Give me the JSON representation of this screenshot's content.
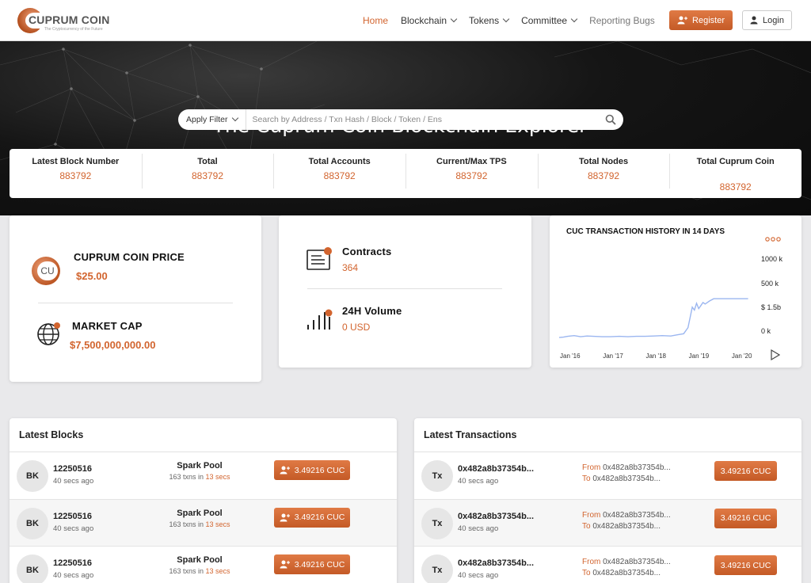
{
  "brand": {
    "name": "CUPRUM COIN",
    "tagline": "The Cryptocurrency of the Future"
  },
  "nav": {
    "items": [
      {
        "label": "Home",
        "active": true,
        "dropdown": false
      },
      {
        "label": "Blockchain",
        "dropdown": true
      },
      {
        "label": "Tokens",
        "dropdown": true
      },
      {
        "label": "Committee",
        "dropdown": true
      },
      {
        "label": "Reporting Bugs",
        "dropdown": false
      }
    ],
    "register": "Register",
    "login": "Login"
  },
  "hero": {
    "title": "The Cuprum Coin Blockchain Explorer",
    "filter_label": "Apply Filter",
    "search_placeholder": "Search by Address / Txn Hash / Block / Token / Ens"
  },
  "stats": [
    {
      "label": "Latest Block Number",
      "value": "883792"
    },
    {
      "label": "Total",
      "value": "883792"
    },
    {
      "label": "Total Accounts",
      "value": "883792"
    },
    {
      "label": "Current/Max TPS",
      "value": "883792"
    },
    {
      "label": "Total Nodes",
      "value": "883792"
    },
    {
      "label": "Total Cuprum Coin",
      "value": "883792"
    }
  ],
  "price": {
    "coin_badge": "CU",
    "price_label": "CUPRUM COIN PRICE",
    "price_value": "$25.00",
    "cap_label": "MARKET CAP",
    "cap_value": "$7,500,000,000.00"
  },
  "contracts": {
    "contracts_label": "Contracts",
    "contracts_value": "364",
    "volume_label": "24H Volume",
    "volume_value": "0 USD"
  },
  "chart_data": {
    "type": "line",
    "title": "CUC TRANSACTION HISTORY IN 14 DAYS",
    "x_ticks": [
      "Jan '16",
      "Jan '17",
      "Jan '18",
      "Jan '19",
      "Jan '20"
    ],
    "y_ticks": [
      "1000 k",
      "500 k",
      "$ 1.5b",
      "0 k"
    ],
    "ylim": [
      0,
      1000
    ],
    "xlim": [
      2016,
      2020.5
    ],
    "x": [
      2016.0,
      2016.1,
      2016.2,
      2016.35,
      2016.5,
      2016.65,
      2016.8,
      2017.0,
      2017.2,
      2017.4,
      2017.6,
      2017.8,
      2018.0,
      2018.2,
      2018.4,
      2018.6,
      2018.75,
      2018.9,
      2019.0,
      2019.1,
      2019.15,
      2019.2,
      2019.25,
      2019.3,
      2019.35,
      2019.4,
      2019.5,
      2019.6,
      2019.7,
      2019.8,
      2020.0,
      2020.2,
      2020.4
    ],
    "values": [
      20,
      25,
      35,
      45,
      30,
      40,
      35,
      30,
      30,
      35,
      30,
      35,
      35,
      40,
      45,
      40,
      55,
      70,
      150,
      420,
      380,
      470,
      400,
      440,
      480,
      460,
      500,
      530,
      530,
      530,
      530,
      530,
      530
    ],
    "grid": false,
    "line_color": "#9bb6f0"
  },
  "latest_blocks": {
    "title": "Latest Blocks",
    "rows": [
      {
        "avatar": "BK",
        "block": "12250516",
        "age": "40 secs ago",
        "miner": "Spark Pool",
        "txns": "163 txns in",
        "time": "13 secs",
        "amount": "3.49216 CUC"
      },
      {
        "avatar": "BK",
        "block": "12250516",
        "age": "40 secs ago",
        "miner": "Spark Pool",
        "txns": "163 txns in",
        "time": "13 secs",
        "amount": "3.49216 CUC"
      },
      {
        "avatar": "BK",
        "block": "12250516",
        "age": "40 secs ago",
        "miner": "Spark Pool",
        "txns": "163 txns in",
        "time": "13 secs",
        "amount": "3.49216 CUC"
      }
    ]
  },
  "latest_transactions": {
    "title": "Latest Transactions",
    "rows": [
      {
        "avatar": "Tx",
        "hash": "0x482a8b37354b...",
        "age": "40 secs ago",
        "from_label": "From",
        "from": "0x482a8b37354b...",
        "to_label": "To",
        "to": "0x482a8b37354b...",
        "amount": "3.49216 CUC"
      },
      {
        "avatar": "Tx",
        "hash": "0x482a8b37354b...",
        "age": "40 secs ago",
        "from_label": "From",
        "from": "0x482a8b37354b...",
        "to_label": "To",
        "to": "0x482a8b37354b...",
        "amount": "3.49216 CUC"
      },
      {
        "avatar": "Tx",
        "hash": "0x482a8b37354b...",
        "age": "40 secs ago",
        "from_label": "From",
        "from": "0x482a8b37354b...",
        "to_label": "To",
        "to": "0x482a8b37354b...",
        "amount": "3.49216 CUC"
      }
    ]
  },
  "colors": {
    "accent": "#d2642e",
    "hero_bg": "#111111",
    "page_bg": "#e9e9eb"
  }
}
